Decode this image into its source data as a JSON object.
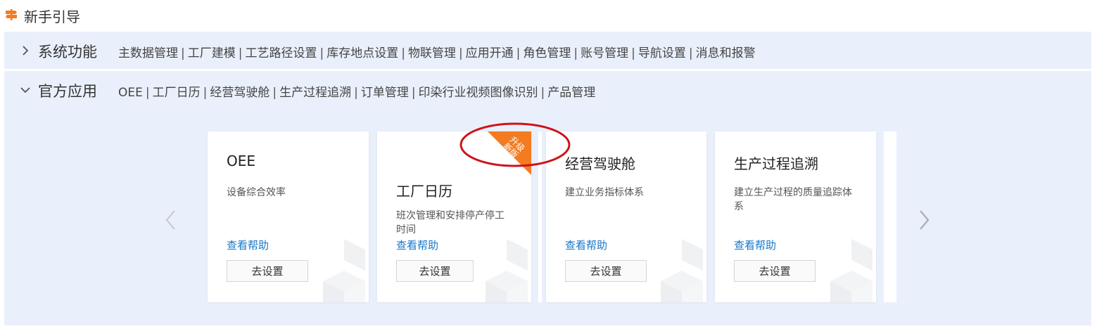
{
  "header": {
    "title": "新手引导",
    "icon": "signpost-icon",
    "icon_color": "#f47b20"
  },
  "sections": [
    {
      "title": "系统功能",
      "expanded": false,
      "links": [
        "主数据管理",
        "工厂建模",
        "工艺路径设置",
        "库存地点设置",
        "物联管理",
        "应用开通",
        "角色管理",
        "账号管理",
        "导航设置",
        "消息和报警"
      ]
    },
    {
      "title": "官方应用",
      "expanded": true,
      "links": [
        "OEE",
        "工厂日历",
        "经营驾驶舱",
        "生产过程追溯",
        "订单管理",
        "印染行业视频图像识别",
        "产品管理"
      ]
    }
  ],
  "cards": [
    {
      "name": "OEE",
      "desc": "设备综合效率",
      "help": "查看帮助",
      "button": "去设置"
    },
    {
      "name": "工厂日历",
      "desc": "班次管理和安排停产停工时间",
      "help": "查看帮助",
      "button": "去设置",
      "badge": "升级新版",
      "badge_color": "#f47b20"
    },
    {
      "name": "经营驾驶舱",
      "desc": "建立业务指标体系",
      "help": "查看帮助",
      "button": "去设置"
    },
    {
      "name": "生产过程追溯",
      "desc": "建立生产过程的质量追踪体系",
      "help": "查看帮助",
      "button": "去设置"
    }
  ],
  "colors": {
    "panel_bg": "#eaf0fb",
    "link_blue": "#1677c8",
    "annotation_red": "#d0121b"
  }
}
